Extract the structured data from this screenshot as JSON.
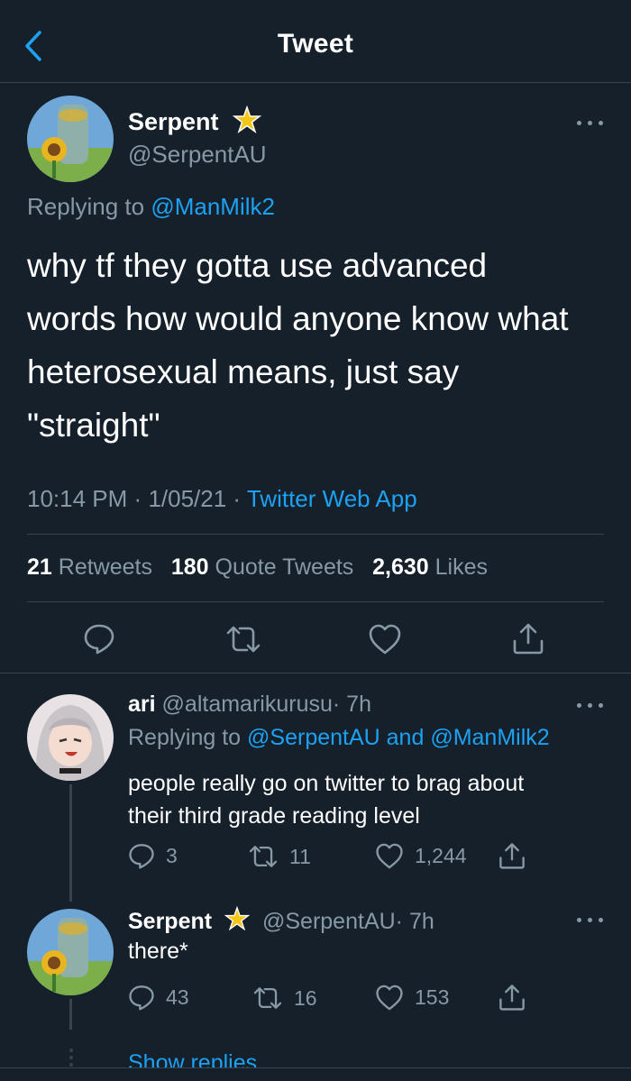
{
  "header": {
    "title": "Tweet"
  },
  "main_tweet": {
    "name": "Serpent",
    "handle": "@SerpentAU",
    "replying_label": "Replying to",
    "replying_to": "@ManMilk2",
    "text_lines": [
      "why tf they gotta use advanced",
      "words how would anyone know what",
      "heterosexual means, just say",
      "\"straight\""
    ],
    "time": "10:14 PM",
    "date": "1/05/21",
    "sep": "·",
    "source": "Twitter Web App",
    "retweets_count": "21",
    "retweets_label": "Retweets",
    "quotes_count": "180",
    "quotes_label": "Quote Tweets",
    "likes_count": "2,630",
    "likes_label": "Likes"
  },
  "reply1": {
    "name": "ari",
    "handle": "@altamarikurusu",
    "time": "· 7h",
    "replying_label": "Replying to",
    "replying_to_1": "@SerpentAU",
    "and": "and",
    "replying_to_2": "@ManMilk2",
    "text_lines": [
      "people really go on twitter to brag about",
      "their third grade reading level"
    ],
    "replies": "3",
    "retweets": "11",
    "likes": "1,244"
  },
  "reply2": {
    "name": "Serpent",
    "handle": "@SerpentAU",
    "time": "· 7h",
    "text": "there*",
    "replies": "43",
    "retweets": "16",
    "likes": "153"
  },
  "show_replies": "Show replies",
  "colors": {
    "background": "#15202b",
    "accent": "#1da1f2",
    "muted": "#8899a6",
    "border": "#38444d",
    "badge": "#f5c518"
  }
}
